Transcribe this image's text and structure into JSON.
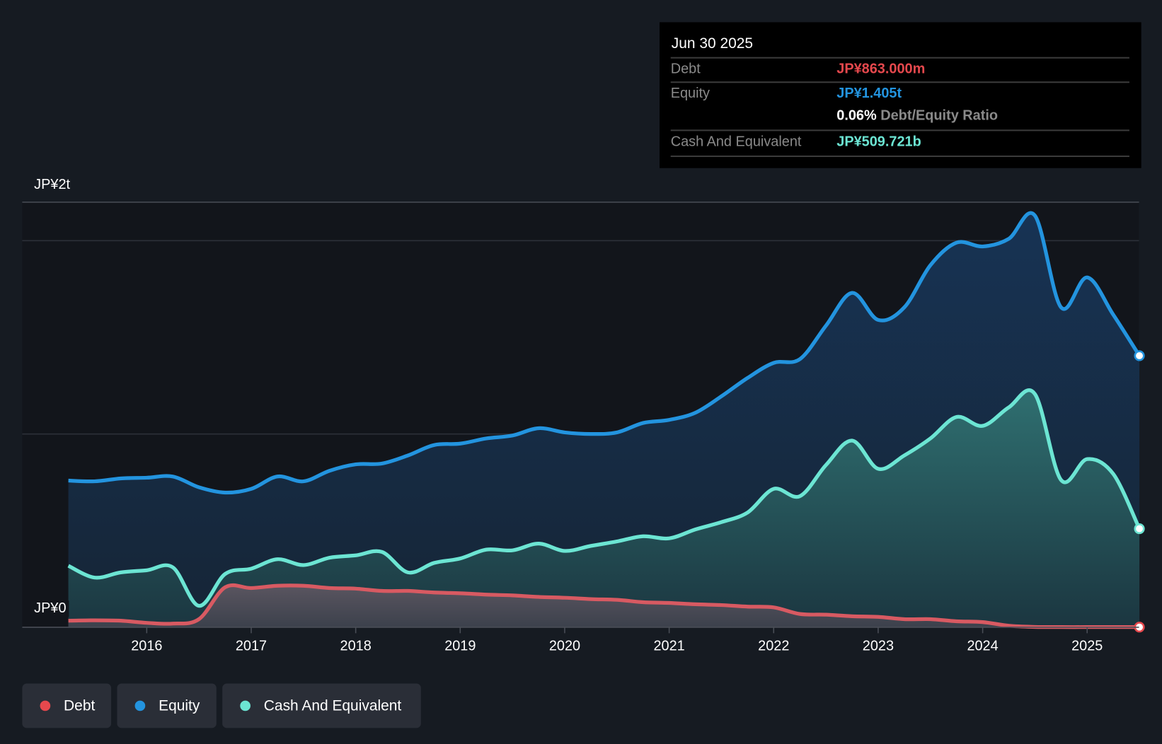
{
  "tooltip": {
    "date": "Jun 30 2025",
    "rows": [
      {
        "label": "Debt",
        "value": "JP¥863.000m",
        "color": "#e5484d"
      },
      {
        "label": "Equity",
        "value": "JP¥1.405t",
        "color": "#2394df"
      },
      {
        "label": "",
        "value": "0.06%",
        "suffix": "Debt/Equity Ratio",
        "color": "#ffffff"
      },
      {
        "label": "Cash And Equivalent",
        "value": "JP¥509.721b",
        "color": "#6ce5d3"
      }
    ]
  },
  "legend": [
    {
      "label": "Debt",
      "color": "#e5484d"
    },
    {
      "label": "Equity",
      "color": "#2394df"
    },
    {
      "label": "Cash And Equivalent",
      "color": "#6ce5d3"
    }
  ],
  "chart_data": {
    "type": "area",
    "title": "",
    "xlabel": "",
    "ylabel": "",
    "y_unit": "JP¥ trillions",
    "ylim": [
      0,
      2
    ],
    "y_tick_labels": [
      "JP¥0",
      "JP¥2t"
    ],
    "x_ticks": [
      2016,
      2017,
      2018,
      2019,
      2020,
      2021,
      2022,
      2023,
      2024,
      2025
    ],
    "x_tick_labels": [
      "2016",
      "2017",
      "2018",
      "2019",
      "2020",
      "2021",
      "2022",
      "2023",
      "2024",
      "2025"
    ],
    "x_start": 2015.25,
    "x_step": 0.25,
    "grid": true,
    "legend_position": "bottom-left",
    "series": [
      {
        "name": "Equity",
        "color": "#2394df",
        "values": [
          0.759,
          0.755,
          0.77,
          0.774,
          0.78,
          0.724,
          0.697,
          0.716,
          0.78,
          0.755,
          0.81,
          0.843,
          0.847,
          0.889,
          0.943,
          0.95,
          0.977,
          0.992,
          1.03,
          1.008,
          1.0,
          1.008,
          1.057,
          1.073,
          1.11,
          1.195,
          1.29,
          1.368,
          1.387,
          1.56,
          1.73,
          1.59,
          1.655,
          1.873,
          1.99,
          1.97,
          2.01,
          2.13,
          1.655,
          1.81,
          1.617,
          1.405
        ]
      },
      {
        "name": "Cash And Equivalent",
        "color": "#6ce5d3",
        "values": [
          0.318,
          0.257,
          0.284,
          0.295,
          0.31,
          0.111,
          0.276,
          0.303,
          0.352,
          0.322,
          0.36,
          0.372,
          0.39,
          0.284,
          0.333,
          0.356,
          0.402,
          0.398,
          0.433,
          0.395,
          0.421,
          0.444,
          0.471,
          0.46,
          0.506,
          0.544,
          0.594,
          0.716,
          0.678,
          0.839,
          0.966,
          0.82,
          0.889,
          0.977,
          1.088,
          1.042,
          1.138,
          1.207,
          0.762,
          0.87,
          0.793,
          0.51
        ]
      },
      {
        "name": "Debt",
        "color": "#e5484d",
        "values": [
          0.034,
          0.036,
          0.034,
          0.023,
          0.019,
          0.042,
          0.207,
          0.203,
          0.215,
          0.215,
          0.203,
          0.2,
          0.188,
          0.188,
          0.18,
          0.176,
          0.169,
          0.165,
          0.157,
          0.153,
          0.146,
          0.142,
          0.13,
          0.126,
          0.119,
          0.115,
          0.107,
          0.103,
          0.069,
          0.065,
          0.057,
          0.054,
          0.042,
          0.042,
          0.031,
          0.027,
          0.008,
          0.002,
          0.001,
          0.001,
          0.001,
          0.001
        ]
      }
    ]
  }
}
